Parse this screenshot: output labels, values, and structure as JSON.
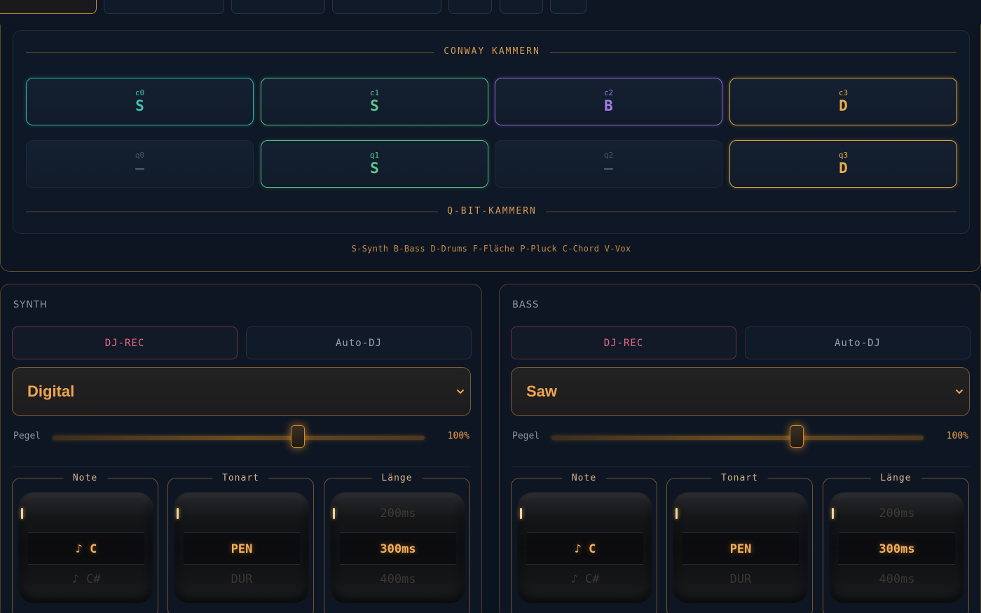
{
  "conway": {
    "top_label": "CONWAY KAMMERN",
    "bottom_label": "Q-BIT-KAMMERN",
    "row1": [
      {
        "id": "c0",
        "value": "S",
        "tone": "teal"
      },
      {
        "id": "c1",
        "value": "S",
        "tone": "green"
      },
      {
        "id": "c2",
        "value": "B",
        "tone": "purple"
      },
      {
        "id": "c3",
        "value": "D",
        "tone": "gold"
      }
    ],
    "row2": [
      {
        "id": "q0",
        "value": "—",
        "tone": "empty"
      },
      {
        "id": "q1",
        "value": "S",
        "tone": "green"
      },
      {
        "id": "q2",
        "value": "—",
        "tone": "empty"
      },
      {
        "id": "q3",
        "value": "D",
        "tone": "gold"
      }
    ],
    "legend": "S-Synth B-Bass D-Drums F-Fläche P-Pluck C-Chord V-Vox"
  },
  "panels": [
    {
      "title": "SYNTH",
      "rec_label": "DJ-REC",
      "auto_label": "Auto-DJ",
      "select_value": "Digital",
      "level_label": "Pegel",
      "level_value": "100%",
      "level_fraction": 0.66,
      "wheels": [
        {
          "label": "Note",
          "prev": "",
          "current": "♪ C",
          "next": "♪ C#"
        },
        {
          "label": "Tonart",
          "prev": "",
          "current": "PEN",
          "next": "DUR"
        },
        {
          "label": "Länge",
          "prev": "200ms",
          "current": "300ms",
          "next": "400ms"
        }
      ]
    },
    {
      "title": "BASS",
      "rec_label": "DJ-REC",
      "auto_label": "Auto-DJ",
      "select_value": "Saw",
      "level_label": "Pegel",
      "level_value": "100%",
      "level_fraction": 0.66,
      "wheels": [
        {
          "label": "Note",
          "prev": "",
          "current": "♪ C",
          "next": "♪ C#"
        },
        {
          "label": "Tonart",
          "prev": "",
          "current": "PEN",
          "next": "DUR"
        },
        {
          "label": "Länge",
          "prev": "200ms",
          "current": "300ms",
          "next": "400ms"
        }
      ]
    }
  ],
  "icons": {
    "select": "chevron-down-icon"
  },
  "colors": {
    "accent": "#f0a54d",
    "teal": "#3cc4b2",
    "green": "#5cc990",
    "purple": "#a07ee6",
    "gold": "#e8ad48",
    "rec": "#e86a87"
  }
}
